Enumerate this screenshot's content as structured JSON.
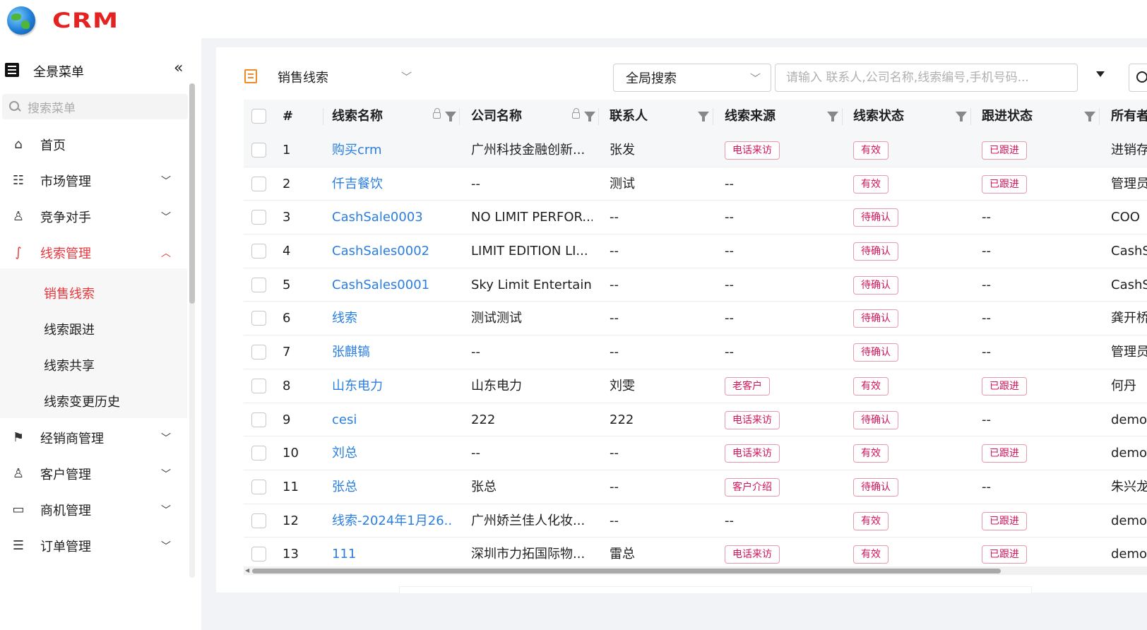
{
  "app": {
    "logo_text": "CRM"
  },
  "sidebar": {
    "header_title": "全景菜单",
    "collapse_glyph": "«",
    "search_placeholder": "搜索菜单",
    "items": [
      {
        "label": "首页",
        "icon": "home-icon",
        "expandable": false
      },
      {
        "label": "市场管理",
        "icon": "store-icon",
        "expandable": true
      },
      {
        "label": "竞争对手",
        "icon": "users-icon",
        "expandable": true
      },
      {
        "label": "线索管理",
        "icon": "lead-icon",
        "expandable": true,
        "active": true
      },
      {
        "label": "经销商管理",
        "icon": "flag-icon",
        "expandable": true
      },
      {
        "label": "客户管理",
        "icon": "customer-icon",
        "expandable": true
      },
      {
        "label": "商机管理",
        "icon": "briefcase-icon",
        "expandable": true
      },
      {
        "label": "订单管理",
        "icon": "order-icon",
        "expandable": true
      }
    ],
    "sub_items": [
      "销售线索",
      "线索跟进",
      "线索共享",
      "线索变更历史"
    ],
    "active_color": "#e8383d"
  },
  "toolbar": {
    "view_label": "销售线索",
    "scope_label": "全局搜索",
    "search_placeholder": "请输入 联系人,公司名称,线索编号,手机号码..."
  },
  "table": {
    "headers": [
      "#",
      "线索名称",
      "公司名称",
      "联系人",
      "线索来源",
      "线索状态",
      "跟进状态",
      "所有者"
    ],
    "rows": [
      {
        "no": "1",
        "name": "购买crm",
        "company": "广州科技金融创新...",
        "contact": "张发",
        "source": "电话来访",
        "status": "有效",
        "follow": "已跟进",
        "owner": "进销存"
      },
      {
        "no": "2",
        "name": "仟吉餐饮",
        "company": "--",
        "contact": "测试",
        "source": "--",
        "status": "有效",
        "follow": "已跟进",
        "owner": "管理员"
      },
      {
        "no": "3",
        "name": "CashSale0003",
        "company": "NO LIMIT PERFOR...",
        "contact": "--",
        "source": "--",
        "status": "待确认",
        "follow": "--",
        "owner": "COO"
      },
      {
        "no": "4",
        "name": "CashSales0002",
        "company": "LIMIT EDITION LI...",
        "contact": "--",
        "source": "--",
        "status": "待确认",
        "follow": "--",
        "owner": "CashS"
      },
      {
        "no": "5",
        "name": "CashSales0001",
        "company": "Sky Limit Entertain...",
        "contact": "--",
        "source": "--",
        "status": "待确认",
        "follow": "--",
        "owner": "CashS"
      },
      {
        "no": "6",
        "name": "线索",
        "company": "测试测试",
        "contact": "--",
        "source": "--",
        "status": "待确认",
        "follow": "--",
        "owner": "龚开桥"
      },
      {
        "no": "7",
        "name": "张麒镐",
        "company": "--",
        "contact": "--",
        "source": "--",
        "status": "待确认",
        "follow": "--",
        "owner": "管理员"
      },
      {
        "no": "8",
        "name": "山东电力",
        "company": "山东电力",
        "contact": "刘雯",
        "source": "老客户",
        "status": "有效",
        "follow": "已跟进",
        "owner": "何丹"
      },
      {
        "no": "9",
        "name": "cesi",
        "company": "222",
        "contact": "222",
        "source": "电话来访",
        "status": "待确认",
        "follow": "--",
        "owner": "demo"
      },
      {
        "no": "10",
        "name": "刘总",
        "company": "--",
        "contact": "--",
        "source": "电话来访",
        "status": "有效",
        "follow": "已跟进",
        "owner": "demo"
      },
      {
        "no": "11",
        "name": "张总",
        "company": "张总",
        "contact": "--",
        "source": "客户介绍",
        "status": "待确认",
        "follow": "--",
        "owner": "朱兴龙"
      },
      {
        "no": "12",
        "name": "线索-2024年1月26...",
        "company": "广州娇兰佳人化妆...",
        "contact": "--",
        "source": "--",
        "status": "有效",
        "follow": "已跟进",
        "owner": "demo"
      },
      {
        "no": "13",
        "name": "111",
        "company": "深圳市力拓国际物...",
        "contact": "雷总",
        "source": "电话来访",
        "status": "有效",
        "follow": "已跟进",
        "owner": "demo"
      }
    ]
  },
  "colors": {
    "link": "#2a7ee0",
    "tag_text": "#d4145a",
    "tag_border": "#e69aaa",
    "logo": "#e52222"
  }
}
